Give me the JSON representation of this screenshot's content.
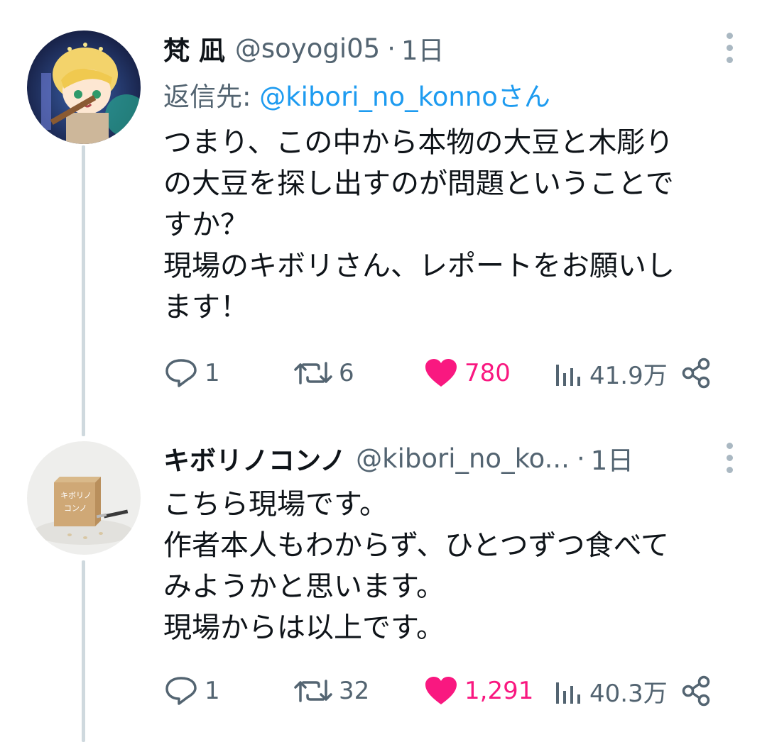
{
  "tweets": [
    {
      "display_name": "梵 凪",
      "handle": "@soyogi05",
      "time": "1日",
      "reply_to_label": "返信先: ",
      "reply_to_mention": "@kibori_no_konnoさん",
      "body_lines": [
        "つまり、この中から本物の大豆と木彫り",
        "の大豆を探し出すのが問題ということで",
        "すか？",
        "現場のキボリさん、レポートをお願いし",
        "ます！"
      ],
      "replies": "1",
      "retweets": "6",
      "likes": "780",
      "views": "41.9万",
      "liked": true
    },
    {
      "display_name": "キボリノコンノ",
      "handle": "@kibori_no_ko...",
      "time": "1日",
      "body_lines": [
        "こちら現場です。",
        "作者本人もわからず、ひとつずつ食べて",
        "みようかと思います。",
        "現場からは以上です。"
      ],
      "replies": "1",
      "retweets": "32",
      "likes": "1,291",
      "views": "40.3万",
      "liked": true
    }
  ],
  "colors": {
    "text": "#0f1419",
    "secondary": "#536471",
    "link": "#1d9bf0",
    "like": "#f91880",
    "thread_line": "#cfd9de"
  },
  "icons": [
    "reply-icon",
    "retweet-icon",
    "heart-icon",
    "views-icon",
    "share-icon",
    "more-icon"
  ]
}
